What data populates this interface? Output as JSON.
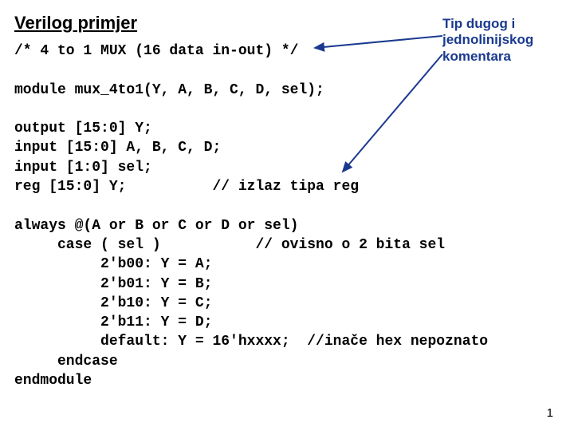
{
  "title": "Verilog primjer",
  "annotation": {
    "line1": "Tip dugog i",
    "line2": "jednolinijskog",
    "line3": "komentara"
  },
  "code": {
    "l1": "/* 4 to 1 MUX (16 data in-out) */",
    "l2": "",
    "l3": "module mux_4to1(Y, A, B, C, D, sel);",
    "l4": "",
    "l5": "output [15:0] Y;",
    "l6": "input [15:0] A, B, C, D;",
    "l7": "input [1:0] sel;",
    "l8": "reg [15:0] Y;          // izlaz tipa reg",
    "l9": "",
    "l10": "always @(A or B or C or D or sel)",
    "l11": "     case ( sel )           // ovisno o 2 bita sel",
    "l12": "          2'b00: Y = A;",
    "l13": "          2'b01: Y = B;",
    "l14": "          2'b10: Y = C;",
    "l15": "          2'b11: Y = D;",
    "l16": "          default: Y = 16'hxxxx;  //inače hex nepoznato",
    "l17": "     endcase",
    "l18": "endmodule"
  },
  "page_number": "1",
  "colors": {
    "arrow": "#1a3a8f"
  }
}
